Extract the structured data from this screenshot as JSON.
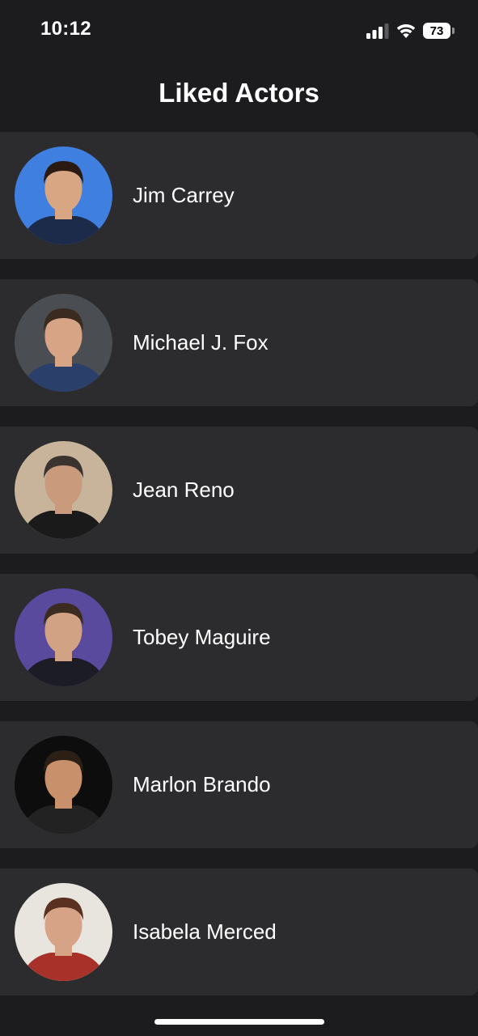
{
  "status_bar": {
    "time": "10:12",
    "battery_level": "73",
    "icons": [
      "signal-icon",
      "wifi-icon",
      "battery-icon"
    ]
  },
  "header": {
    "title": "Liked Actors"
  },
  "actors": [
    {
      "name": "Jim Carrey",
      "avatar_bg": "#3f7fe0",
      "skin": "#d9a684",
      "hair": "#2a1a12",
      "clothes": "#1c2b4a"
    },
    {
      "name": "Michael J. Fox",
      "avatar_bg": "#4a4d52",
      "skin": "#d7a585",
      "hair": "#3a2a20",
      "clothes": "#2b3f6b"
    },
    {
      "name": "Jean Reno",
      "avatar_bg": "#c7b49a",
      "skin": "#c99a7c",
      "hair": "#3a3330",
      "clothes": "#1a1a1a"
    },
    {
      "name": "Tobey Maguire",
      "avatar_bg": "#5a4a9e",
      "skin": "#d2a285",
      "hair": "#3b2b20",
      "clothes": "#1c1c26"
    },
    {
      "name": "Marlon Brando",
      "avatar_bg": "#0d0d0d",
      "skin": "#c8916c",
      "hair": "#2c2016",
      "clothes": "#222222"
    },
    {
      "name": "Isabela Merced",
      "avatar_bg": "#e8e4de",
      "skin": "#d6a387",
      "hair": "#5a3020",
      "clothes": "#a8322a"
    }
  ],
  "colors": {
    "background": "#1c1c1e",
    "card": "#2c2c2e",
    "text": "#ffffff"
  }
}
